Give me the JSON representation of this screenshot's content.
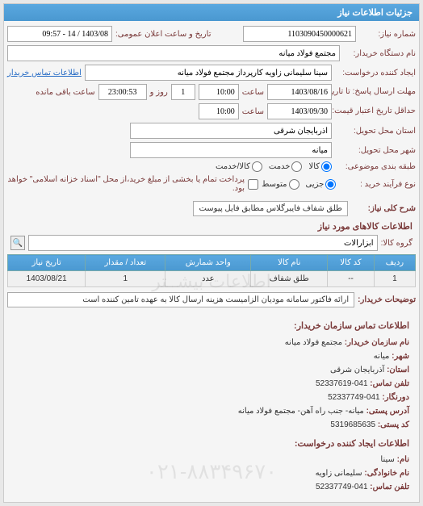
{
  "panel_title": "جزئیات اطلاعات نیاز",
  "fields": {
    "req_no_label": "شماره نیاز:",
    "req_no": "1103090450000621",
    "announce_label": "تاریخ و ساعت اعلان عمومی:",
    "announce": "1403/08 / 14 - 09:57",
    "buyer_org_label": "نام دستگاه خریدار:",
    "buyer_org": "مجتمع فولاد میانه",
    "creator_label": "ایجاد کننده درخواست:",
    "creator": "سینا سلیمانی زاویه کارپرداز مجتمع فولاد میانه",
    "contact_link": "اطلاعات تماس خریدار",
    "deadline_label": "مهلت ارسال پاسخ: تا تاریخ:",
    "deadline_date": "1403/08/16",
    "time_label": "ساعت",
    "deadline_time": "10:00",
    "days_remain": "1",
    "days_and": "روز و",
    "time_remain": "23:00:53",
    "time_remain_label": "ساعت باقی مانده",
    "validity_label": "حداقل تاریخ اعتبار قیمت: تا تاریخ:",
    "validity_date": "1403/09/30",
    "validity_time": "10:00",
    "province_label": "استان محل تحویل:",
    "province": "آذربایجان شرقی",
    "city_label": "شهر محل تحویل:",
    "city": "میانه",
    "type_label": "طبقه بندی موضوعی:",
    "type_kala": "کالا",
    "type_khedmat": "خدمت",
    "type_both": "کالا/خدمت",
    "process_label": "نوع فرآیند خرید :",
    "proc_partial": "جزیی",
    "proc_medium": "متوسط",
    "proc_note": "پرداخت تمام یا بخشی از مبلغ خرید،از محل \"اسناد خزانه اسلامی\" خواهد بود.",
    "summary_label": "شرح کلی نیاز:",
    "summary": "طلق شفاف فایبرگلاس مطابق فایل پیوست",
    "group_label": "گروه کالا:",
    "group": "ابزارآلات"
  },
  "items_title": "اطلاعات کالاهای مورد نیاز",
  "table": {
    "headers": [
      "ردیف",
      "کد کالا",
      "نام کالا",
      "واحد شمارش",
      "تعداد / مقدار",
      "تاریخ نیاز"
    ],
    "row": [
      "1",
      "--",
      "طلق شفاف",
      "عدد",
      "1",
      "1403/08/21"
    ]
  },
  "buyer_desc_label": "توضیحات خریدار:",
  "buyer_desc": "ارائه فاکتور سامانه مودیان الزامیست هزینه ارسال کالا به عهده تامین کننده است",
  "contact_title": "اطلاعات تماس سازمان خریدار:",
  "contact": {
    "org_label": "نام سازمان خریدار:",
    "org": "مجتمع فولاد میانه",
    "city_label": "شهر:",
    "city": "میانه",
    "province_label": "استان:",
    "province": "آذربایجان شرقی",
    "phone_label": "تلفن تماس:",
    "phone": "041-52337619",
    "fax_label": "دورنگار:",
    "fax": "041-52337749",
    "address_label": "آدرس پستی:",
    "address": "میانه- جنب راه آهن- مجتمع فولاد میانه",
    "postal_label": "کد پستی:",
    "postal": "5319685635"
  },
  "requester_title": "اطلاعات ایجاد کننده درخواست:",
  "requester": {
    "name_label": "نام:",
    "name": "سینا",
    "lname_label": "نام خانوادگی:",
    "lname": "سلیمانی زاویه",
    "phone_label": "تلفن تماس:",
    "phone": "041-52337749"
  },
  "watermark1": "اطلاعات بیشــتر",
  "watermark2": "۰۲۱-۸۸۳۴۹۶۷۰"
}
